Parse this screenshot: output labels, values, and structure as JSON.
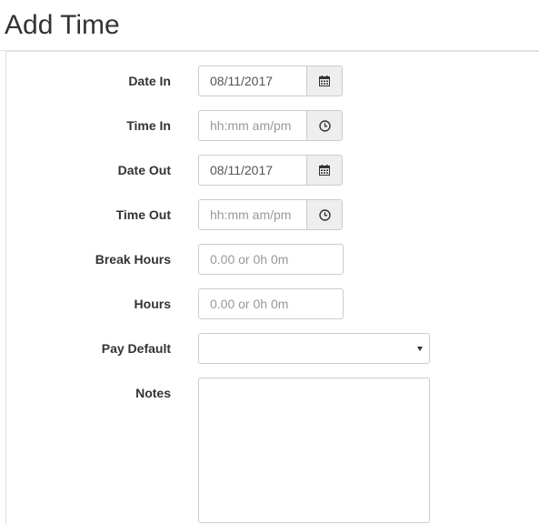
{
  "page": {
    "title": "Add Time"
  },
  "form": {
    "date_in": {
      "label": "Date In",
      "value": "08/11/2017",
      "icon": "calendar-icon"
    },
    "time_in": {
      "label": "Time In",
      "value": "",
      "placeholder": "hh:mm am/pm",
      "icon": "clock-icon"
    },
    "date_out": {
      "label": "Date Out",
      "value": "08/11/2017",
      "icon": "calendar-icon"
    },
    "time_out": {
      "label": "Time Out",
      "value": "",
      "placeholder": "hh:mm am/pm",
      "icon": "clock-icon"
    },
    "break_hours": {
      "label": "Break Hours",
      "value": "",
      "placeholder": "0.00 or 0h 0m"
    },
    "hours": {
      "label": "Hours",
      "value": "",
      "placeholder": "0.00 or 0h 0m"
    },
    "pay_default": {
      "label": "Pay Default",
      "selected": ""
    },
    "notes": {
      "label": "Notes",
      "value": ""
    }
  },
  "colors": {
    "addon_background": "#eeeeee",
    "border": "#cccccc",
    "label_text": "#333333",
    "placeholder_text": "#999999"
  }
}
